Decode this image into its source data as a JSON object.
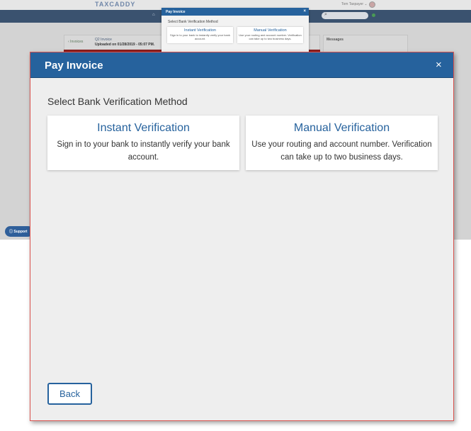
{
  "background_page": {
    "logo": "TAXCADDY",
    "user_name": "Tom Taxpayer ⌄",
    "home_icon": "home-icon",
    "search_icon": "search-icon",
    "back_link": "‹ Invoices",
    "invoice_title": "Q2 Invoice",
    "invoice_subtitle": "Uploaded on 01/28/2019 - 05:07 PM.",
    "messages_title": "Messages",
    "support_button": "Support"
  },
  "preview_dialog": {
    "title": "Pay Invoice",
    "close": "×",
    "subtitle": "Select Bank Verification Method",
    "instant": {
      "title": "Instant Verification",
      "description": "Sign in to your bank to instantly verify your bank account."
    },
    "manual": {
      "title": "Manual Verification",
      "description": "Use your routing and account number. Verification can take up to two business days."
    }
  },
  "modal": {
    "title": "Pay Invoice",
    "close": "×",
    "subtitle": "Select Bank Verification Method",
    "options": [
      {
        "title": "Instant Verification",
        "description": "Sign in to your bank to instantly verify your bank account."
      },
      {
        "title": "Manual Verification",
        "description": "Use your routing and account number. Verification can take up to two business days."
      }
    ],
    "back_button": "Back"
  },
  "colors": {
    "header_blue": "#26629d",
    "modal_border": "#d9534f",
    "modal_body": "#eeeeee",
    "card_title_blue": "#26629d"
  }
}
